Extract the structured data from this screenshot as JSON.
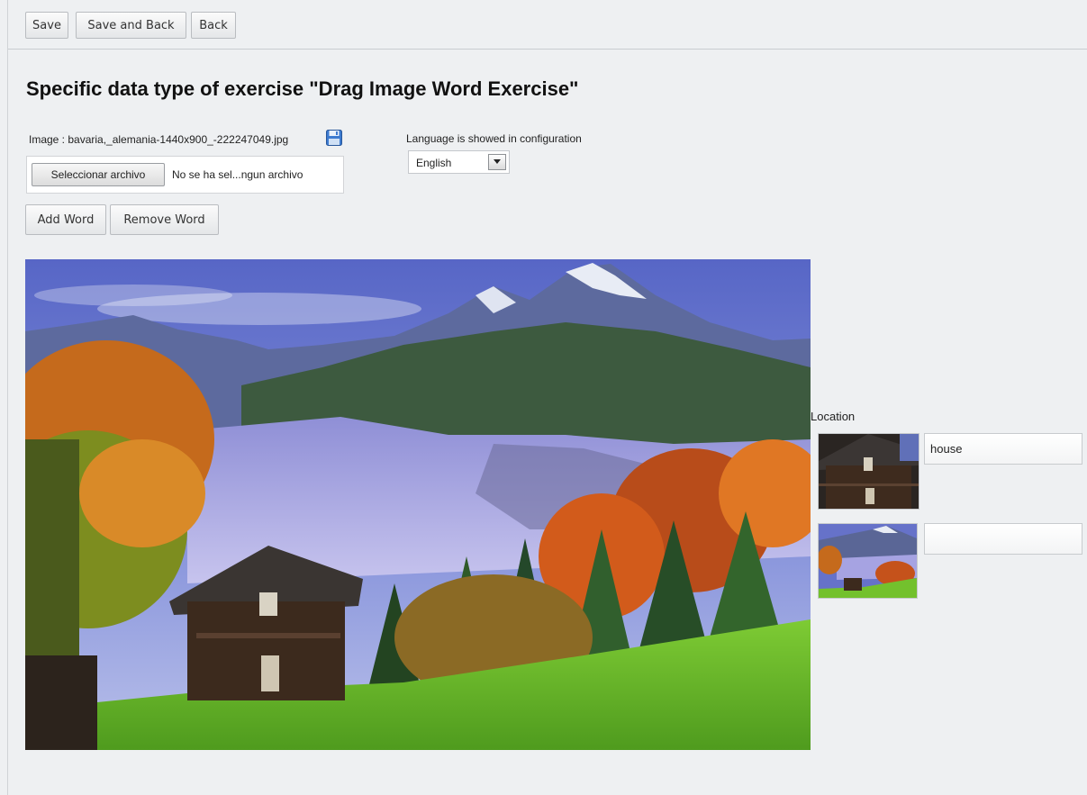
{
  "toolbar": {
    "save_label": "Save",
    "save_back_label": "Save and Back",
    "back_label": "Back"
  },
  "page_title": "Specific data type of exercise \"Drag Image Word Exercise\"",
  "image_field": {
    "label": "Image : bavaria,_alemania-1440x900_-222247049.jpg",
    "choose_button": "Seleccionar archivo",
    "no_file_text": "No se ha sel...ngun archivo",
    "save_icon": "floppy-disk-icon"
  },
  "language": {
    "label": "Language is showed in configuration",
    "selected": "English"
  },
  "word_buttons": {
    "add": "Add Word",
    "remove": "Remove Word"
  },
  "location": {
    "label": "Location",
    "items": [
      {
        "value": "house",
        "thumb": "house-crop-thumbnail"
      },
      {
        "value": "",
        "thumb": "landscape-thumbnail"
      }
    ]
  },
  "colors": {
    "page_bg": "#eef0f2",
    "sky": "#5a69c9",
    "grass": "#6fbd2d",
    "autumn": "#d86a1f"
  }
}
